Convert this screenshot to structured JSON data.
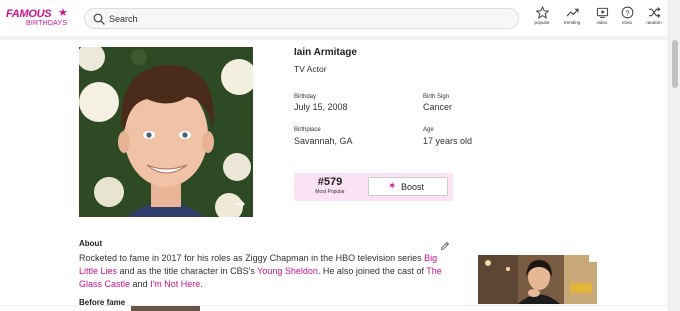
{
  "brand": {
    "logo_top": "FAMOUS",
    "logo_bottom": "BIRTHDAYS"
  },
  "search": {
    "placeholder": "Search"
  },
  "nav": [
    {
      "label": "popular",
      "icon": "star-icon"
    },
    {
      "label": "trending",
      "icon": "trending-icon"
    },
    {
      "label": "video",
      "icon": "video-icon"
    },
    {
      "label": "trivia",
      "icon": "question-icon"
    },
    {
      "label": "random",
      "icon": "shuffle-icon"
    }
  ],
  "profile": {
    "name": "Iain Armitage",
    "profession": "TV Actor",
    "birthday_label": "Birthday",
    "birthday": "July 15, 2008",
    "birth_sign_label": "Birth Sign",
    "birth_sign": "Cancer",
    "birthplace_label": "Birthplace",
    "birthplace": "Savannah, GA",
    "age_label": "Age",
    "age": "17 years old"
  },
  "rank": {
    "number": "#579",
    "label": "Most Popular",
    "boost_label": "Boost"
  },
  "about": {
    "heading": "About",
    "t1": "Rocketed to fame in 2017 for his roles as Ziggy Chapman in the HBO television series ",
    "link1": "Big Little Lies",
    "t2": " and as the title character in CBS's ",
    "link2": "Young Sheldon",
    "t3": ". He also joined the cast of ",
    "link3": "The Glass Castle",
    "t4": " and ",
    "link4": "I'm Not Here",
    "t5": "."
  },
  "before_fame": {
    "heading": "Before fame"
  },
  "colors": {
    "accent": "#c7138e",
    "rank_background": "#fbe3f3"
  }
}
